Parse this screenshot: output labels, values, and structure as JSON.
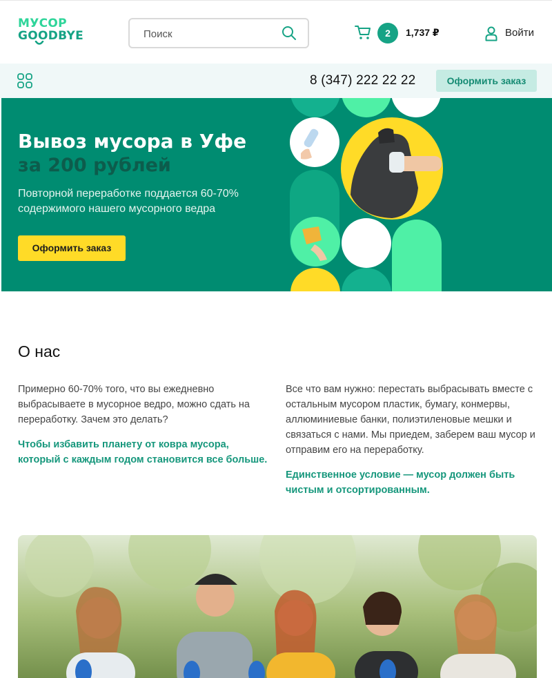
{
  "header": {
    "logo_line1": "МУСОР",
    "logo_line2": "GOODBYE",
    "search_placeholder": "Поиск",
    "cart_count": "2",
    "cart_total": "1,737 ₽",
    "login_label": "Войти"
  },
  "subbar": {
    "phone": "8 (347) 222 22 22",
    "order_button": "Оформить заказ"
  },
  "hero": {
    "title": "Вывоз мусора в Уфе",
    "subtitle": "за 200 рублей",
    "description": "Повторной переработке поддается 60-70% содержимого нашего мусорного ведра",
    "cta": "Оформить заказ"
  },
  "about": {
    "title": "О нас",
    "left_text": "Примерно 60-70% того, что вы ежедневно выбрасываете в мусорное ведро, можно сдать на переработку. Зачем это делать?",
    "left_highlight": "Чтобы избавить планету от ковра мусора, который с каждым годом становится все больше.",
    "right_text": "Все что вам нужно: перестать выбрасывать вместе с остальным мусором пластик, бумагу, конмервы, аллюминиевые банки, полиэтиленовые мешки и связаться с нами. Мы приедем, заберем ваш мусор и отправим его на переработку.",
    "right_highlight": "Единственное условие — мусор должен быть чистым и отсортированным."
  },
  "colors": {
    "brand_green": "#16a385",
    "hero_bg": "#008c71",
    "accent_yellow": "#ffdb27",
    "mint": "#4ff0a6"
  }
}
